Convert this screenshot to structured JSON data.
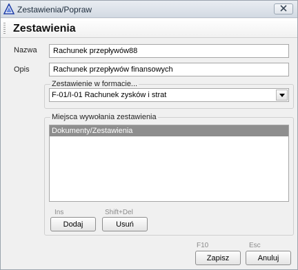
{
  "window": {
    "title": "Zestawienia/Popraw",
    "icon": "triangle-app-icon",
    "close_icon": "close-icon"
  },
  "header": {
    "title": "Zestawienia"
  },
  "form": {
    "name_label": "Nazwa",
    "name_value": "Rachunek przepływów88",
    "description_label": "Opis",
    "description_value": "Rachunek przepływów finansowych"
  },
  "format_group": {
    "legend": "Zestawienie w formacie...",
    "selected": "F-01/I-01 Rachunek zysków i strat"
  },
  "places_group": {
    "legend": "Miejsca wywołania zestawienia",
    "items": [
      "Dokumenty/Zestawienia"
    ],
    "add_hint": "Ins",
    "add_label": "Dodaj",
    "remove_hint": "Shift+Del",
    "remove_label": "Usuń"
  },
  "footer": {
    "save_hint": "F10",
    "save_label": "Zapisz",
    "cancel_hint": "Esc",
    "cancel_label": "Anuluj"
  },
  "colors": {
    "selection": "#8e8e8e",
    "window_bg": "#f0f0f0"
  }
}
